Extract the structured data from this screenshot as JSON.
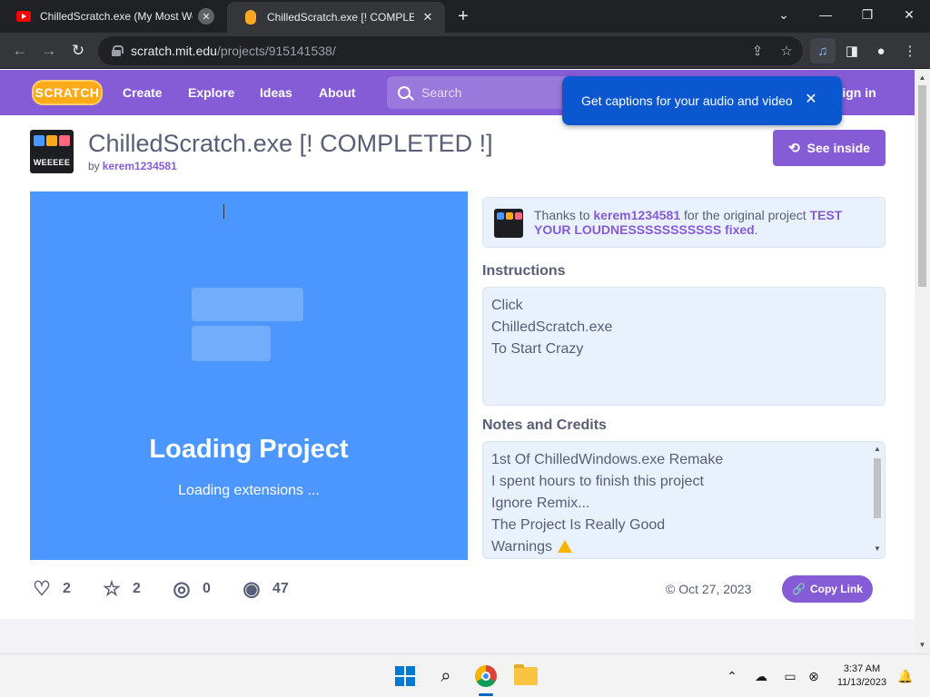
{
  "browser": {
    "tabs": [
      {
        "title": "ChilledScratch.exe (My Most Wo",
        "active": false
      },
      {
        "title": "ChilledScratch.exe [! COMPLETED",
        "active": true
      }
    ],
    "new_tab": "+",
    "window_controls": {
      "minimize": "—",
      "restore": "❐",
      "close": "✕",
      "tab_list": "⌄"
    },
    "url": {
      "host": "scratch.mit.edu",
      "path": "/projects/915141538/"
    },
    "nav": {
      "back": "←",
      "forward": "→",
      "reload": "↻"
    }
  },
  "scratch_nav": {
    "logo": "SCRATCH",
    "links": [
      "Create",
      "Explore",
      "Ideas",
      "About"
    ],
    "search_placeholder": "Search",
    "sign_in": "Sign in"
  },
  "captions_popup": {
    "text": "Get captions for your audio and video",
    "close": "✕"
  },
  "project": {
    "thumb_text": "WEEEEE",
    "title": "ChilledScratch.exe [! COMPLETED !]",
    "by_label": "by",
    "author": "kerem1234581",
    "see_inside": "See inside",
    "stage": {
      "loading_title": "Loading Project",
      "loading_sub": "Loading extensions ..."
    },
    "remix": {
      "prefix": "Thanks to",
      "author": "kerem1234581",
      "middle": "for the original project",
      "original_title": "TEST YOUR LOUDNESSSSSSSSSSS fixed",
      "suffix": "."
    },
    "instructions_heading": "Instructions",
    "instructions": [
      "Click",
      "ChilledScratch.exe",
      "To Start Crazy"
    ],
    "notes_heading": "Notes and Credits",
    "notes": [
      "1st Of ChilledWindows.exe Remake",
      "I spent hours to finish this project",
      "Ignore Remix...",
      "The Project Is Really Good",
      "Warnings"
    ],
    "stats": {
      "loves": "2",
      "favorites": "2",
      "remixes": "0",
      "views": "47"
    },
    "date": "Oct 27, 2023",
    "copy_link": "Copy Link"
  },
  "taskbar": {
    "time": "3:37 AM",
    "date": "11/13/2023"
  },
  "colors": {
    "scratch_purple": "#855cd6",
    "stage_blue": "#4c97ff",
    "captions_blue": "#0b57d0",
    "chrome_dark": "#202124"
  }
}
